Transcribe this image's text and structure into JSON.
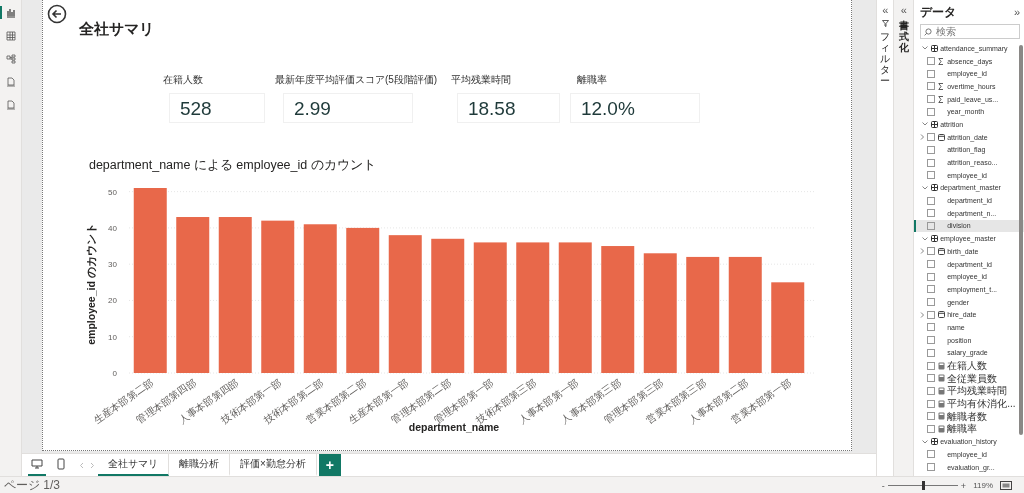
{
  "rail": [
    {
      "kind": "report",
      "selected": true
    },
    {
      "kind": "table",
      "selected": false
    },
    {
      "kind": "model",
      "selected": false
    },
    {
      "kind": "dax",
      "selected": false
    },
    {
      "kind": "tmdl",
      "selected": false
    }
  ],
  "page": {
    "title": "全社サマリ"
  },
  "kpis": [
    {
      "label": "在籍人数",
      "value": "528"
    },
    {
      "label": "最新年度平均評価スコア(5段階評価)",
      "value": "2.99"
    },
    {
      "label": "平均残業時間",
      "value": "18.58"
    },
    {
      "label": "離職率",
      "value": "12.0%"
    }
  ],
  "chart": {
    "title": "department_name による employee_id のカウント",
    "chart_data": {
      "type": "bar",
      "xlabel": "department_name",
      "ylabel": "employee_id のカウント",
      "categories": [
        "生産本部第二部",
        "管理本部第四部",
        "人事本部第四部",
        "技術本部第一部",
        "技術本部第二部",
        "営業本部第二部",
        "生産本部第一部",
        "管理本部第二部",
        "管理本部第一部",
        "技術本部第三部",
        "人事本部第一部",
        "人事本部第三部",
        "管理本部第三部",
        "営業本部第三部",
        "人事本部第二部",
        "営業本部第一部"
      ],
      "series": [
        {
          "color": "#e8684a",
          "values": [
            51,
            43,
            43,
            42,
            41,
            40,
            38,
            37,
            36,
            36,
            36,
            35,
            33,
            32,
            32,
            25
          ]
        }
      ],
      "ylim": [
        0,
        51
      ],
      "yticks": [
        0,
        10,
        20,
        30,
        40,
        50
      ],
      "grid": true
    }
  },
  "filter_pane": {
    "collapse": "«",
    "title": "フィルター"
  },
  "format_pane": {
    "collapse": "«",
    "title": "書式化"
  },
  "data_pane": {
    "title": "データ",
    "expand": "»",
    "search": {
      "placeholder": "検索"
    },
    "tables": [
      {
        "name": "attendance_summary",
        "expanded": true,
        "fields": [
          {
            "name": "absence_days",
            "kind": "sum",
            "checked": false,
            "selected": false
          },
          {
            "name": "employee_id",
            "kind": "column",
            "checked": false,
            "selected": false
          },
          {
            "name": "overtime_hours",
            "kind": "sum",
            "checked": false,
            "selected": false
          },
          {
            "name": "paid_leave_us...",
            "kind": "sum",
            "checked": false,
            "selected": false
          },
          {
            "name": "year_month",
            "kind": "column",
            "checked": false,
            "selected": false
          }
        ]
      },
      {
        "name": "attrition",
        "expanded": true,
        "fields": [
          {
            "name": "attrition_date",
            "kind": "date",
            "checked": false,
            "selected": false
          },
          {
            "name": "attrition_flag",
            "kind": "column",
            "checked": false,
            "selected": false
          },
          {
            "name": "attrition_reaso...",
            "kind": "column",
            "checked": false,
            "selected": false
          },
          {
            "name": "employee_id",
            "kind": "column",
            "checked": false,
            "selected": false
          }
        ]
      },
      {
        "name": "department_master",
        "expanded": true,
        "fields": [
          {
            "name": "department_id",
            "kind": "column",
            "checked": false,
            "selected": false
          },
          {
            "name": "department_n...",
            "kind": "column",
            "checked": false,
            "selected": false
          },
          {
            "name": "division",
            "kind": "column",
            "checked": false,
            "selected": true
          }
        ]
      },
      {
        "name": "employee_master",
        "expanded": true,
        "fields": [
          {
            "name": "birth_date",
            "kind": "date",
            "checked": false,
            "selected": false
          },
          {
            "name": "department_id",
            "kind": "column",
            "checked": false,
            "selected": false
          },
          {
            "name": "employee_id",
            "kind": "column",
            "checked": false,
            "selected": false
          },
          {
            "name": "employment_t...",
            "kind": "column",
            "checked": false,
            "selected": false
          },
          {
            "name": "gender",
            "kind": "column",
            "checked": false,
            "selected": false
          },
          {
            "name": "hire_date",
            "kind": "date",
            "checked": false,
            "selected": false
          },
          {
            "name": "name",
            "kind": "column",
            "checked": false,
            "selected": false
          },
          {
            "name": "position",
            "kind": "column",
            "checked": false,
            "selected": false
          },
          {
            "name": "salary_grade",
            "kind": "column",
            "checked": false,
            "selected": false
          },
          {
            "name": "在籍人数",
            "kind": "measure",
            "checked": false,
            "selected": false
          },
          {
            "name": "全従業員数",
            "kind": "measure",
            "checked": false,
            "selected": false
          },
          {
            "name": "平均残業時間",
            "kind": "measure",
            "checked": false,
            "selected": false
          },
          {
            "name": "平均有休消化...",
            "kind": "measure",
            "checked": false,
            "selected": false
          },
          {
            "name": "離職者数",
            "kind": "measure",
            "checked": false,
            "selected": false
          },
          {
            "name": "離職率",
            "kind": "measure",
            "checked": false,
            "selected": false
          }
        ]
      },
      {
        "name": "evaluation_history",
        "expanded": true,
        "fields": [
          {
            "name": "employee_id",
            "kind": "column",
            "checked": false,
            "selected": false
          },
          {
            "name": "evaluation_gr...",
            "kind": "column",
            "checked": false,
            "selected": false
          }
        ]
      }
    ]
  },
  "view_buttons": [
    {
      "kind": "desktop",
      "selected": true
    },
    {
      "kind": "phone",
      "selected": false
    }
  ],
  "page_tabs": [
    {
      "label": "全社サマリ",
      "selected": true
    },
    {
      "label": "離職分析",
      "selected": false
    },
    {
      "label": "評価×勤怠分析",
      "selected": false
    }
  ],
  "add_page": "+",
  "status_bar": {
    "page": "ページ 1/3",
    "zoom_out": "-",
    "zoom_in": "+",
    "zoom": {
      "level": 0.5
    },
    "zoom_percent": "119%"
  }
}
